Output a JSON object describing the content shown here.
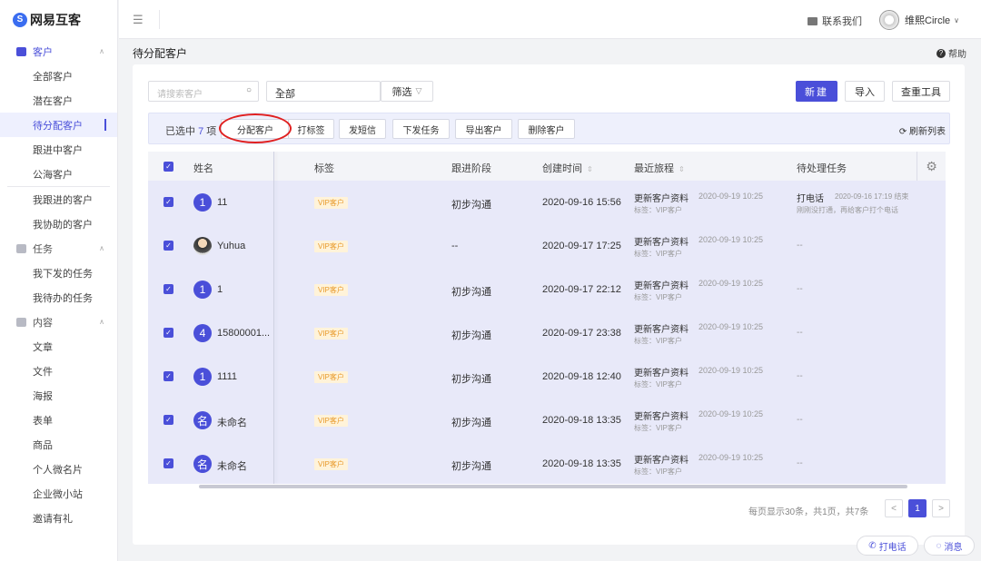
{
  "brand": {
    "name": "网易互客",
    "mark": "S"
  },
  "sidebar": {
    "groups": [
      {
        "label": "客户",
        "items": [
          "全部客户",
          "潜在客户",
          "待分配客户",
          "跟进中客户",
          "公海客户"
        ],
        "extra": [
          "我跟进的客户",
          "我协助的客户"
        ]
      },
      {
        "label": "任务",
        "items": [
          "我下发的任务",
          "我待办的任务"
        ]
      },
      {
        "label": "内容",
        "items": [
          "文章",
          "文件",
          "海报",
          "表单",
          "商品",
          "个人微名片",
          "企业微小站",
          "邀请有礼"
        ]
      }
    ]
  },
  "topbar": {
    "menu_icon": "menu-fold-icon",
    "contact": "联系我们",
    "user": "维熙Circle"
  },
  "page": {
    "title": "待分配客户",
    "help": "帮助"
  },
  "toolbar": {
    "search_placeholder": "请搜索客户",
    "select_value": "全部",
    "filter_label": "筛选",
    "new_label": "新建",
    "import_label": "导入",
    "dedupe_label": "查重工具"
  },
  "actions": {
    "selected_prefix": "已选中",
    "selected_count": "7",
    "selected_suffix": "项",
    "buttons": [
      "分配客户",
      "打标签",
      "发短信",
      "下发任务",
      "导出客户",
      "删除客户"
    ],
    "refresh": "刷新列表"
  },
  "table": {
    "columns": [
      "姓名",
      "标签",
      "跟进阶段",
      "创建时间",
      "最近旅程",
      "待处理任务"
    ],
    "rows": [
      {
        "avatar": "1",
        "name": "11",
        "tag": "VIP客户",
        "stage": "初步沟通",
        "created": "2020-09-16 15:56",
        "journey": "更新客户资料",
        "journey_time": "2020-09-19 10:25",
        "journey_sub": "标签：VIP客户",
        "task": "打电话",
        "task_time": "2020-09-16 17:19 结束",
        "task_sub": "刚刚没打通，再给客户打个电话"
      },
      {
        "avatar": "photo",
        "name": "Yuhua",
        "tag": "VIP客户",
        "stage": "--",
        "created": "2020-09-17 17:25",
        "journey": "更新客户资料",
        "journey_time": "2020-09-19 10:25",
        "journey_sub": "标签：VIP客户",
        "task": "--"
      },
      {
        "avatar": "1",
        "name": "1",
        "tag": "VIP客户",
        "stage": "初步沟通",
        "created": "2020-09-17 22:12",
        "journey": "更新客户资料",
        "journey_time": "2020-09-19 10:25",
        "journey_sub": "标签：VIP客户",
        "task": "--"
      },
      {
        "avatar": "4",
        "name": "15800001...",
        "tag": "VIP客户",
        "stage": "初步沟通",
        "created": "2020-09-17 23:38",
        "journey": "更新客户资料",
        "journey_time": "2020-09-19 10:25",
        "journey_sub": "标签：VIP客户",
        "task": "--"
      },
      {
        "avatar": "1",
        "name": "1111",
        "tag": "VIP客户",
        "stage": "初步沟通",
        "created": "2020-09-18 12:40",
        "journey": "更新客户资料",
        "journey_time": "2020-09-19 10:25",
        "journey_sub": "标签：VIP客户",
        "task": "--"
      },
      {
        "avatar": "名",
        "name": "未命名",
        "tag": "VIP客户",
        "stage": "初步沟通",
        "created": "2020-09-18 13:35",
        "journey": "更新客户资料",
        "journey_time": "2020-09-19 10:25",
        "journey_sub": "标签：VIP客户",
        "task": "--"
      },
      {
        "avatar": "名",
        "name": "未命名",
        "tag": "VIP客户",
        "stage": "初步沟通",
        "created": "2020-09-18 13:35",
        "journey": "更新客户资料",
        "journey_time": "2020-09-19 10:25",
        "journey_sub": "标签：VIP客户",
        "task": "--"
      }
    ]
  },
  "pagination": {
    "info": "每页显示30条，共1页，共7条",
    "current": "1",
    "prev": "<",
    "next": ">"
  },
  "floating": {
    "call": "打电话",
    "message": "消息"
  },
  "colors": {
    "accent": "#4a4fd9",
    "highlight_ring": "#e02020",
    "vip_text": "#e89a2c"
  }
}
